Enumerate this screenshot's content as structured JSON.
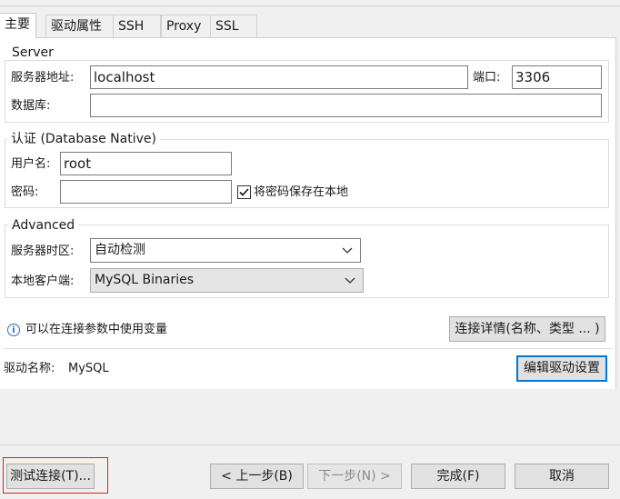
{
  "tabs": [
    "主要",
    "驱动属性",
    "SSH",
    "Proxy",
    "SSL"
  ],
  "server_group": {
    "title": "Server",
    "host_label": "服务器地址:",
    "host_value": "localhost",
    "port_label": "端口:",
    "port_value": "3306",
    "database_label": "数据库:",
    "database_value": ""
  },
  "auth_group": {
    "title": "认证 (Database Native)",
    "username_label": "用户名:",
    "username_value": "root",
    "password_label": "密码:",
    "password_value": "",
    "save_password_label": "将密码保存在本地",
    "save_password_checked": true
  },
  "advanced_group": {
    "title": "Advanced",
    "timezone_label": "服务器时区:",
    "timezone_value": "自动检测",
    "client_label": "本地客户端:",
    "client_value": "MySQL Binaries"
  },
  "info": {
    "text": "可以在连接参数中使用变量",
    "details_button": "连接详情(名称、类型 ... )"
  },
  "driver": {
    "label": "驱动名称:",
    "value": "MySQL",
    "edit_button": "编辑驱动设置"
  },
  "footer": {
    "test_button": "测试连接(T)...",
    "back_button": "< 上一步(B)",
    "next_button": "下一步(N) >",
    "finish_button": "完成(F)",
    "cancel_button": "取消"
  }
}
